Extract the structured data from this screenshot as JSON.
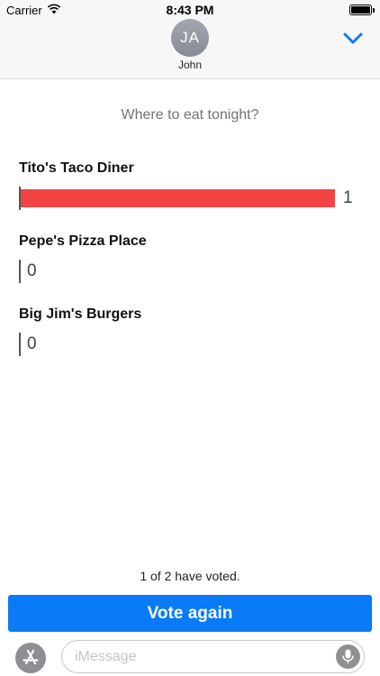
{
  "status_bar": {
    "carrier": "Carrier",
    "time": "8:43 PM",
    "wifi_icon": "wifi-icon",
    "battery_icon": "battery-icon"
  },
  "header": {
    "avatar_initials": "JA",
    "contact_name": "John",
    "collapse_icon": "chevron-down-icon",
    "accent_color": "#0a7bf7"
  },
  "poll": {
    "question": "Where to eat tonight?",
    "bar_color": "#f24443",
    "total_votes": 1,
    "options": [
      {
        "label": "Tito's Taco Diner",
        "votes": 1,
        "count": "1"
      },
      {
        "label": "Pepe's Pizza Place",
        "votes": 0,
        "count": "0"
      },
      {
        "label": "Big Jim's Burgers",
        "votes": 0,
        "count": "0"
      }
    ],
    "status": "1 of 2 have voted.",
    "vote_again_label": "Vote again"
  },
  "input_bar": {
    "placeholder": "iMessage",
    "app_store_icon": "app-store-icon",
    "mic_icon": "microphone-icon"
  }
}
